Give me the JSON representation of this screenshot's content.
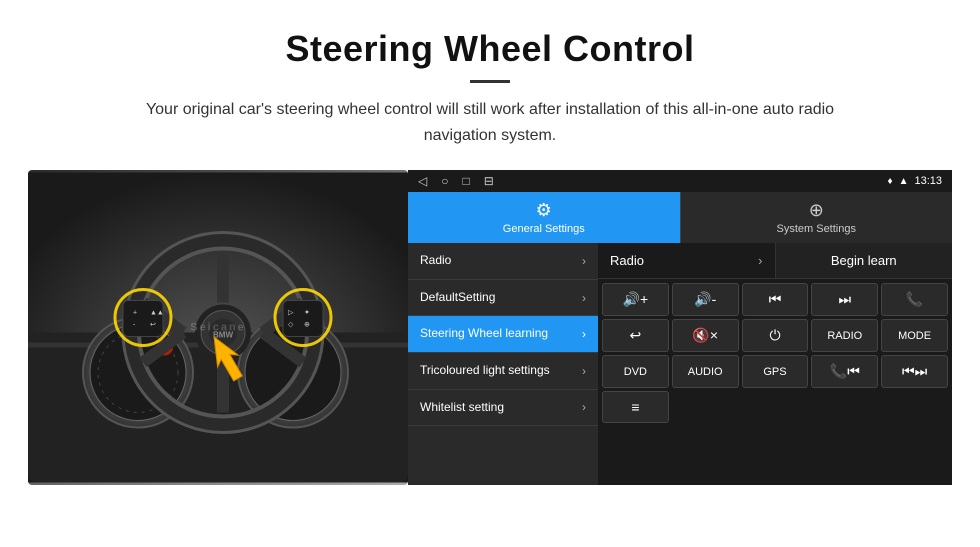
{
  "header": {
    "title": "Steering Wheel Control",
    "subtitle": "Your original car's steering wheel control will still work after installation of this all-in-one auto radio navigation system."
  },
  "android": {
    "status_bar": {
      "time": "13:13",
      "nav_icons": [
        "◁",
        "○",
        "□",
        "⊟"
      ]
    },
    "tabs": [
      {
        "label": "General Settings",
        "icon": "⚙",
        "active": true
      },
      {
        "label": "System Settings",
        "icon": "⊕",
        "active": false
      }
    ],
    "menu_items": [
      {
        "label": "Radio",
        "active": false
      },
      {
        "label": "DefaultSetting",
        "active": false
      },
      {
        "label": "Steering Wheel learning",
        "active": true
      },
      {
        "label": "Tricoloured light settings",
        "active": false
      },
      {
        "label": "Whitelist setting",
        "active": false
      }
    ],
    "controls": {
      "top_row": {
        "left_label": "Radio",
        "right_label": "Begin learn"
      },
      "button_rows": [
        [
          {
            "label": "🔇+",
            "type": "icon"
          },
          {
            "label": "🔇-",
            "type": "icon"
          },
          {
            "label": "⏮",
            "type": "icon"
          },
          {
            "label": "⏭",
            "type": "icon"
          },
          {
            "label": "📞",
            "type": "icon"
          }
        ],
        [
          {
            "label": "↩",
            "type": "icon"
          },
          {
            "label": "🔇✕",
            "type": "icon"
          },
          {
            "label": "⏻",
            "type": "icon"
          },
          {
            "label": "RADIO",
            "type": "text"
          },
          {
            "label": "MODE",
            "type": "text"
          }
        ],
        [
          {
            "label": "DVD",
            "type": "text"
          },
          {
            "label": "AUDIO",
            "type": "text"
          },
          {
            "label": "GPS",
            "type": "text"
          },
          {
            "label": "📞⏮",
            "type": "icon"
          },
          {
            "label": "⏮⏭",
            "type": "icon"
          }
        ],
        [
          {
            "label": "🗒",
            "type": "icon"
          }
        ]
      ]
    }
  },
  "icons": {
    "vol_up": "🔊+",
    "vol_down": "🔊-",
    "prev": "⏮",
    "next": "⏭",
    "phone": "📞",
    "hang_up": "↩",
    "mute": "🔇",
    "power": "⏻",
    "radio": "RADIO",
    "mode": "MODE",
    "dvd": "DVD",
    "audio": "AUDIO",
    "gps": "GPS",
    "list": "≡"
  }
}
